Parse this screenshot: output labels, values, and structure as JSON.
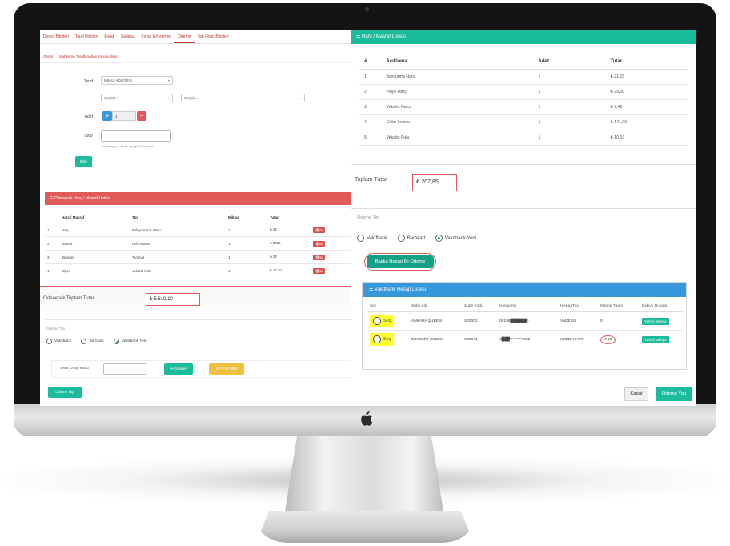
{
  "left": {
    "tabs": [
      "Dosya Bilgileri",
      "Taraf Bilgileri",
      "Evrak",
      "Safahat",
      "Evrak Gönderme",
      "Ödeme",
      "Tah./Red. Bilgileri"
    ],
    "subtabs": [
      "Genel",
      "Mahkeme Taraflarından Kaydedilmiş"
    ],
    "form": {
      "taraf_label": "Taraf",
      "taraf_value": "MİLAS ADLİYESİ",
      "select1": "Seçiniz...",
      "select2": "Seçiniz...",
      "adet_label": "Adet",
      "adet_value": "1",
      "plus": "+",
      "minus": "−",
      "tutar_label": "Tutar",
      "tutar_hint": "Kuruş ayracı olarak , (virgül) kullanınız.",
      "ekle": "Ekle"
    },
    "list_title": "Ödenecek Harç / Masraf Listesi",
    "columns": [
      "",
      "Harç / Masraf",
      "Tür",
      "Miktar",
      "Tutar",
      ""
    ],
    "rows": [
      {
        "n": "1",
        "name": "Harç",
        "tur": "Bakiye Karar Harcı",
        "miktar": "1",
        "tutar": "₺ 21",
        "sil": "Sil"
      },
      {
        "n": "2",
        "name": "Masraf",
        "tur": "Delil Avansı",
        "miktar": "1",
        "tutar": "₺ 5555",
        "sil": "Sil"
      },
      {
        "n": "3",
        "name": "Tahsilat",
        "tur": "Teminat",
        "miktar": "1",
        "tutar": "₺ 33",
        "sil": "Sil"
      },
      {
        "n": "4",
        "name": "Diğer",
        "tur": "Vekalet Pulu",
        "miktar": "1",
        "tutar": "₺ 10.10",
        "sil": "Sil"
      }
    ],
    "total_label": "Ödenecek Toplam Tutar",
    "total_value": "₺ 5.619,10",
    "odeme_tipi": "Ödeme Tipi",
    "radios": [
      "Vakıfbank",
      "Barokart",
      "Vakıfbank Yeni"
    ],
    "sms_label": "SMS Onay Kodu",
    "gonder": "Gönder",
    "yeni_sms": "YENİ SMS",
    "odeme_yap": "Ödeme Yap"
  },
  "right": {
    "title": "Harç / Masraf Listesi",
    "columns": [
      "#",
      "Açıklama",
      "Adet",
      "Tutar"
    ],
    "rows": [
      {
        "n": "1",
        "aciklama": "Başvurma Harcı",
        "adet": "1",
        "tutar": "₺ 21,15"
      },
      {
        "n": "2",
        "aciklama": "Peşin Harç",
        "adet": "1",
        "tutar": "₺ 29,20"
      },
      {
        "n": "3",
        "aciklama": "Vekalet Harcı",
        "adet": "1",
        "tutar": "₺ 6,40"
      },
      {
        "n": "4",
        "aciklama": "Gider Avansı",
        "adet": "1",
        "tutar": "₺ 141,00"
      },
      {
        "n": "5",
        "aciklama": "Vekalet Pulu",
        "adet": "1",
        "tutar": "₺ 10,10"
      }
    ],
    "total_label": "Toplam Tutar",
    "total_value": "₺ 207,85",
    "odeme_tipi": "Ödeme Tipi",
    "radios": [
      "Vakıfbank",
      "Barokart",
      "Vakıfbank Yeni"
    ],
    "baska_hesap": "Başka Hesap İle Ödeme",
    "bank_title": "Vakıfbank Hesap Listesi",
    "bank_columns": [
      "Seç",
      "Şube Adı",
      "Şube Kodu",
      "Hesap No",
      "Hesap Tipi",
      "Masraf Tutarı",
      "Bakiye Durumu"
    ],
    "bank_rows": [
      {
        "sec": "Seç",
        "sube": "ANKARA ŞUBESİ",
        "kod": "S00002",
        "hesap": "00158██████0",
        "tip": "VADESİZ",
        "masraf": "0",
        "bakiye": "Yeterli Bakiye"
      },
      {
        "sec": "Seç",
        "sube": "EDREMİT ŞUBESİ",
        "kod": "S00041",
        "hesap": "4███********3962",
        "tip": "KREDİ KARTI",
        "masraf": "4.16",
        "bakiye": "Yeterli Bakiye"
      }
    ],
    "kapat": "Kapat",
    "odeme_yap": "Ödeme Yap"
  },
  "colors": {
    "teal": "#1abc9c",
    "red": "#e05a5a",
    "blue": "#3498db",
    "highlight": "#ffff33"
  }
}
